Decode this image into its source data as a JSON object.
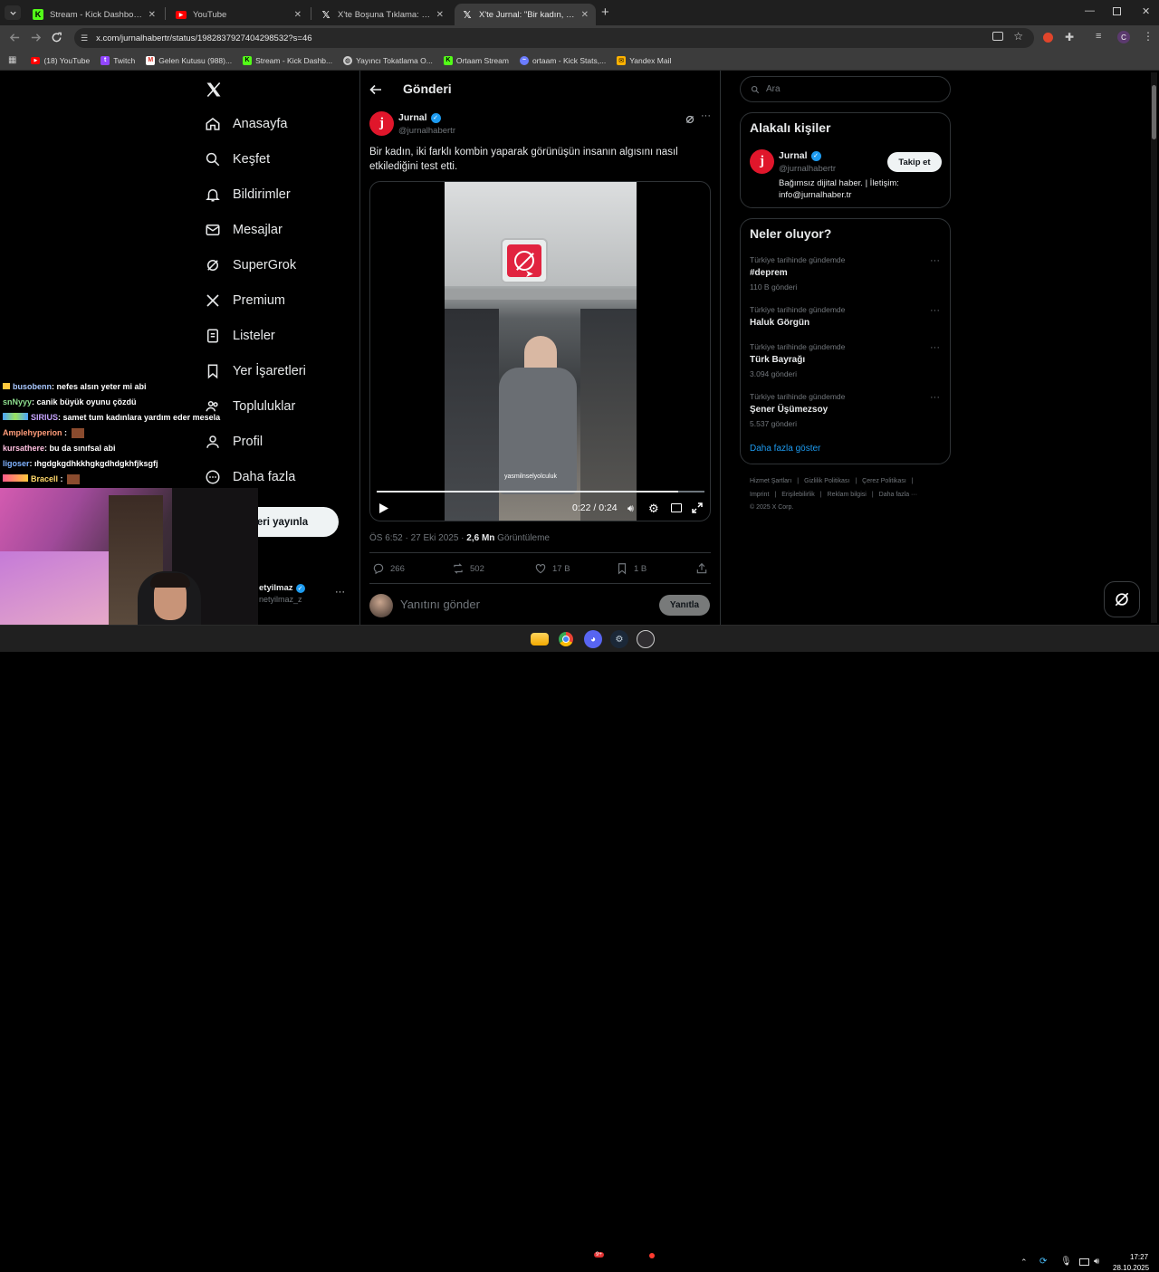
{
  "browser": {
    "tabs": [
      {
        "label": "Stream - Kick Dashboard",
        "icon": "kick-icon"
      },
      {
        "label": "YouTube",
        "icon": "youtube-icon"
      },
      {
        "label": "X'te Boşuna Tıklama: \"Düzce'de",
        "icon": "x-icon"
      },
      {
        "label": "X'te Jurnal: \"Bir kadın, iki far",
        "icon": "x-icon",
        "active": true
      }
    ],
    "new_tab": "+",
    "url": "x.com/jurnalhabertr/status/1982837927404298532?s=46",
    "bookmarks": [
      {
        "label": "(18) YouTube",
        "icon": "youtube-icon"
      },
      {
        "label": "Twitch",
        "icon": "twitch-icon"
      },
      {
        "label": "Gelen Kutusu (988)...",
        "icon": "gmail-icon"
      },
      {
        "label": "Stream - Kick Dashb...",
        "icon": "kick-icon"
      },
      {
        "label": "Yayıncı Tokatlama O...",
        "icon": "globe-icon"
      },
      {
        "label": "Ortaam Stream",
        "icon": "kick-icon"
      },
      {
        "label": "ortaam - Kick Stats,...",
        "icon": "stats-icon"
      },
      {
        "label": "Yandex Mail",
        "icon": "mail-icon"
      }
    ],
    "profile_initial": "C"
  },
  "sidebar": {
    "items": [
      {
        "label": "Anasayfa",
        "icon": "home-icon"
      },
      {
        "label": "Keşfet",
        "icon": "search-icon"
      },
      {
        "label": "Bildirimler",
        "icon": "bell-icon"
      },
      {
        "label": "Mesajlar",
        "icon": "mail-icon"
      },
      {
        "label": "SuperGrok",
        "icon": "grok-icon"
      },
      {
        "label": "Premium",
        "icon": "x-icon"
      },
      {
        "label": "Listeler",
        "icon": "list-icon"
      },
      {
        "label": "Yer İşaretleri",
        "icon": "bookmark-icon"
      },
      {
        "label": "Topluluklar",
        "icon": "community-icon"
      },
      {
        "label": "Profil",
        "icon": "user-icon"
      },
      {
        "label": "Daha fazla",
        "icon": "more-circle-icon"
      }
    ],
    "post_button": "eri yayınla",
    "account_name": "etyilmaz",
    "account_handle": "netyilmaz_z",
    "account_more": "···"
  },
  "post": {
    "header_title": "Gönderi",
    "author_name": "Jurnal",
    "author_handle": "@jurnalhabertr",
    "author_initial": "j",
    "text": "Bir kadın, iki farklı kombin yaparak görünüşün insanın algısını nasıl etkilediğini test etti.",
    "video": {
      "time": "0:22 / 0:24",
      "caption": "yasmilnselyolculuk",
      "progress": 0.92
    },
    "timestamp": "ÖS 6:52 · 27 Eki 2025 · ",
    "views_value": "2,6 Mn",
    "views_label": " Görüntüleme",
    "stats": {
      "replies": "266",
      "reposts": "502",
      "likes": "17 B",
      "bookmarks": "1 B"
    },
    "reply_placeholder": "Yanıtını gönder",
    "reply_button": "Yanıtla"
  },
  "right": {
    "search_placeholder": "Ara",
    "related_title": "Alakalı kişiler",
    "related": {
      "name": "Jurnal",
      "handle": "@jurnalhabertr",
      "bio": "Bağımsız dijital haber. | İletişim: info@jurnalhaber.tr",
      "follow": "Takip et"
    },
    "trends_title": "Neler oluyor?",
    "trends": [
      {
        "category": "Türkiye tarihinde gündemde",
        "name": "#deprem",
        "count": "110 B gönderi"
      },
      {
        "category": "Türkiye tarihinde gündemde",
        "name": "Haluk Görgün",
        "count": ""
      },
      {
        "category": "Türkiye tarihinde gündemde",
        "name": "Türk Bayrağı",
        "count": "3.094 gönderi"
      },
      {
        "category": "Türkiye tarihinde gündemde",
        "name": "Şener Üşümezsoy",
        "count": "5.537 gönderi"
      }
    ],
    "show_more": "Daha fazla göster",
    "footer": {
      "row1": [
        "Hizmet Şartları",
        "Gizlilik Politikası",
        "Çerez Politikası"
      ],
      "row2": [
        "Imprint",
        "Erişilebilirlik",
        "Reklam bilgisi",
        "Daha fazla ···"
      ],
      "copyright": "© 2025 X Corp."
    }
  },
  "chat": [
    {
      "user": "busobenn",
      "msg": ": nefes alsın yeter mi abi",
      "color": "#a9c8ff"
    },
    {
      "user": "snNyyy",
      "msg": ": canik büyük oyunu çözdü",
      "color": "#8fe08f"
    },
    {
      "user": "SIRIUS",
      "msg": ": samet tum kadınlara yardım eder mesela",
      "color": "#c7a5ff"
    },
    {
      "user": "Amplehyperion",
      "msg": " :",
      "color": "#ff9c7a"
    },
    {
      "user": "kursathere",
      "msg": ": bu da sınıfsal abi",
      "color": "#ffc0e0"
    },
    {
      "user": "ligoser",
      "msg": ": ıhgdgkgdhkkhgkgdhdgkhfjksgfj",
      "color": "#7fb2ff"
    },
    {
      "user": "Bracell",
      "msg": " :",
      "color": "#ffd86b"
    }
  ],
  "taskbar": {
    "time": "17:27",
    "date": "28.10.2025",
    "discord_badge": "9+"
  },
  "colors": {
    "accent": "#1d9bf0",
    "verified": "#1d9bf0",
    "jurnal_red": "#e0162b",
    "kick_green": "#53fc18"
  }
}
